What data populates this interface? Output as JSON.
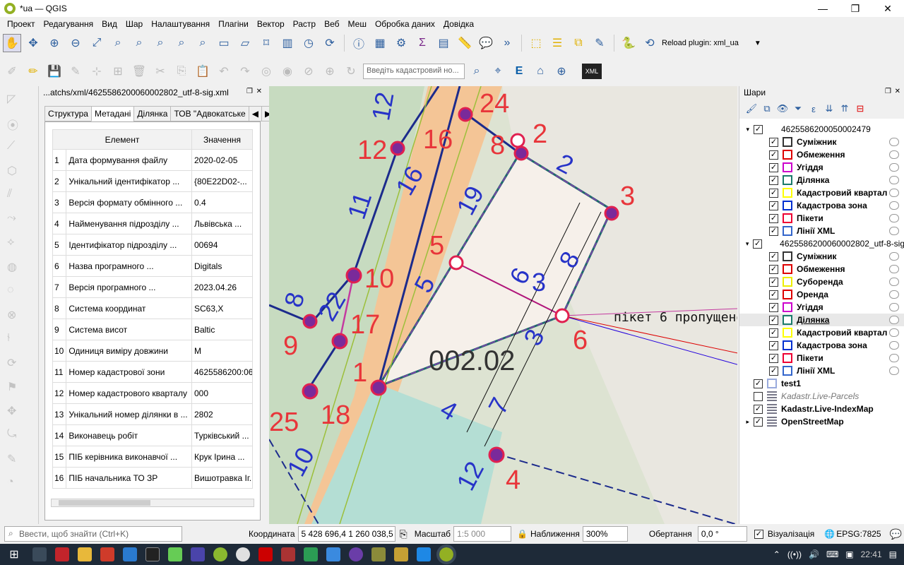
{
  "window": {
    "title": "*ua — QGIS",
    "buttons": {
      "minimize": "—",
      "maximize": "❐",
      "close": "✕"
    }
  },
  "menu": [
    "Проект",
    "Редагування",
    "Вид",
    "Шар",
    "Налаштування",
    "Плагіни",
    "Вектор",
    "Растр",
    "Веб",
    "Меш",
    "Обробка даних",
    "Довідка"
  ],
  "toolbar": {
    "plugin_label": "Reload plugin: xml_ua",
    "cadastral_placeholder": "Введіть кадастровий но...",
    "xml_icon_text": "XML"
  },
  "xml_panel": {
    "title": "...atchs/xml/4625586200060002802_utf-8-sig.xml",
    "tabs": [
      "Структура",
      "Метадані",
      "Ділянка",
      "ТОВ \"Адвокатське"
    ],
    "columns": {
      "element": "Елемент",
      "value": "Значення"
    },
    "rows": [
      {
        "n": "1",
        "element": "Дата формування файлу",
        "value": "2020-02-05"
      },
      {
        "n": "2",
        "element": "Унікальний ідентифікатор ...",
        "value": "{80E22D02-..."
      },
      {
        "n": "3",
        "element": "Версія формату обмінного ...",
        "value": "0.4"
      },
      {
        "n": "4",
        "element": "Найменування підрозділу ...",
        "value": "Львівська ..."
      },
      {
        "n": "5",
        "element": "Ідентифікатор підрозділу ...",
        "value": "00694"
      },
      {
        "n": "6",
        "element": "Назва програмного ...",
        "value": "Digitals"
      },
      {
        "n": "7",
        "element": "Версія програмного ...",
        "value": "2023.04.26"
      },
      {
        "n": "8",
        "element": "Система координат",
        "value": "SC63,X"
      },
      {
        "n": "9",
        "element": "Система висот",
        "value": "Baltic"
      },
      {
        "n": "10",
        "element": "Одиниця виміру довжини",
        "value": "M"
      },
      {
        "n": "11",
        "element": "Номер кадастрової зони",
        "value": "4625586200:06"
      },
      {
        "n": "12",
        "element": "Номер кадастрового кварталу",
        "value": "000"
      },
      {
        "n": "13",
        "element": "Унікальний номер ділянки в ...",
        "value": "2802"
      },
      {
        "n": "14",
        "element": "Виконавець робіт",
        "value": "Турківський ..."
      },
      {
        "n": "15",
        "element": "ПІБ керівника виконавчої ...",
        "value": "Крук Ірина ..."
      },
      {
        "n": "16",
        "element": "ПІБ начальника ТО ЗР",
        "value": "Вишотравка Іг..."
      }
    ]
  },
  "map": {
    "parcel_label": "002.02",
    "annotation": "пікет 6 пропущено",
    "red_labels": [
      "12",
      "24",
      "16",
      "8",
      "2",
      "3",
      "5",
      "10",
      "17",
      "9",
      "1",
      "18",
      "25",
      "6",
      "4"
    ],
    "blue_labels": [
      "12",
      "11",
      "16",
      "19",
      "2",
      "5",
      "6",
      "3",
      "8",
      "3",
      "8",
      "22",
      "4",
      "7",
      "12",
      "10"
    ]
  },
  "layers": {
    "title": "Шари",
    "groups": [
      {
        "name": "4625586200050002479",
        "children": [
          "Суміжник",
          "Обмеження",
          "Угіддя",
          "Ділянка",
          "Кадастровий квартал",
          "Кадастрова зона",
          "Пікети",
          "Лінії XML"
        ]
      },
      {
        "name": "4625586200060002802_utf-8-sig",
        "children": [
          "Суміжник",
          "Обмеження",
          "Суборенда",
          "Оренда",
          "Угіддя",
          "Ділянка",
          "Кадастровий квартал",
          "Кадастрова зона",
          "Пікети",
          "Лінії XML"
        ]
      }
    ],
    "others": [
      {
        "name": "test1",
        "checked": true,
        "style": "bold"
      },
      {
        "name": "Kadastr.Live-Parcels",
        "checked": false,
        "style": "italic"
      },
      {
        "name": "Kadastr.Live-IndexMap",
        "checked": true,
        "style": "bold"
      },
      {
        "name": "OpenStreetMap",
        "checked": true,
        "style": "bold"
      }
    ]
  },
  "status": {
    "search_placeholder": "Ввести, щоб знайти (Ctrl+K)",
    "coord_label": "Координата",
    "coord_value": "5 428 696,4  1 260 038,5",
    "scale_label": "Масштаб",
    "scale_value": "1:5 000",
    "zoom_label": "Наближення",
    "zoom_value": "300%",
    "rotation_label": "Обертання",
    "rotation_value": "0,0 °",
    "render_label": "Візуалізація",
    "crs": "EPSG:7825"
  },
  "taskbar": {
    "time": "22:41"
  }
}
